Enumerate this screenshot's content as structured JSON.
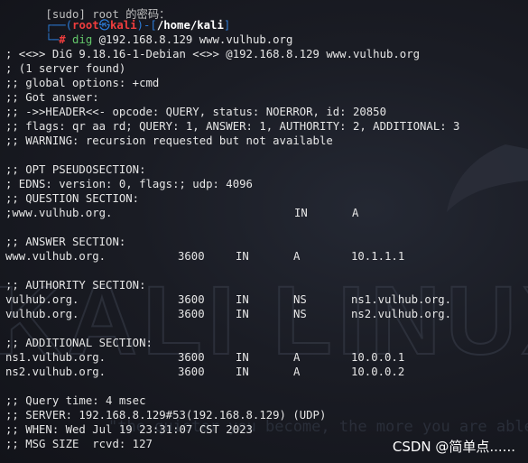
{
  "prompt": {
    "top_partial": "[sudo] root 的密码：",
    "frame_open": "┌──(",
    "user": "root",
    "skull": "㉿",
    "host": "kali",
    "frame_mid": ")-[",
    "path": "/home/kali",
    "frame_close": "]",
    "frame_bottom": "└─",
    "hash": "#",
    "command_name": "dig",
    "command_args": "@192.168.8.129 www.vulhub.org"
  },
  "header_lines": [
    "; <<>> DiG 9.18.16-1-Debian <<>> @192.168.8.129 www.vulhub.org",
    "; (1 server found)",
    ";; global options: +cmd",
    ";; Got answer:",
    ";; ->>HEADER<<- opcode: QUERY, status: NOERROR, id: 20850",
    ";; flags: qr aa rd; QUERY: 1, ANSWER: 1, AUTHORITY: 2, ADDITIONAL: 3",
    ";; WARNING: recursion requested but not available"
  ],
  "opt_lines": [
    ";; OPT PSEUDOSECTION:",
    "; EDNS: version: 0, flags:; udp: 4096",
    ";; QUESTION SECTION:"
  ],
  "question": {
    "name": ";www.vulhub.org.",
    "class": "IN",
    "type": "A"
  },
  "answer_title": ";; ANSWER SECTION:",
  "answer": [
    {
      "name": "www.vulhub.org.",
      "ttl": "3600",
      "class": "IN",
      "type": "A",
      "data": "10.1.1.1"
    }
  ],
  "authority_title": ";; AUTHORITY SECTION:",
  "authority": [
    {
      "name": "vulhub.org.",
      "ttl": "3600",
      "class": "IN",
      "type": "NS",
      "data": "ns1.vulhub.org."
    },
    {
      "name": "vulhub.org.",
      "ttl": "3600",
      "class": "IN",
      "type": "NS",
      "data": "ns2.vulhub.org."
    }
  ],
  "additional_title": ";; ADDITIONAL SECTION:",
  "additional": [
    {
      "name": "ns1.vulhub.org.",
      "ttl": "3600",
      "class": "IN",
      "type": "A",
      "data": "10.0.0.1"
    },
    {
      "name": "ns2.vulhub.org.",
      "ttl": "3600",
      "class": "IN",
      "type": "A",
      "data": "10.0.0.2"
    }
  ],
  "footer_lines": [
    ";; Query time: 4 msec",
    ";; SERVER: 192.168.8.129#53(192.168.8.129) (UDP)",
    ";; WHEN: Wed Jul 19 23:31:07 CST 2023",
    ";; MSG SIZE  rcvd: 127"
  ],
  "background": {
    "watermark_text": "KALI LINUX",
    "tagline": "\"the quieter you become, the more you are able to hear\""
  },
  "credit": "CSDN @简单点......",
  "colors": {
    "prompt_frame": "#2c7bd6",
    "prompt_user": "#ef3d3d",
    "command": "#63c76a",
    "text": "#e6e6e6",
    "background": "#1a1c24"
  }
}
